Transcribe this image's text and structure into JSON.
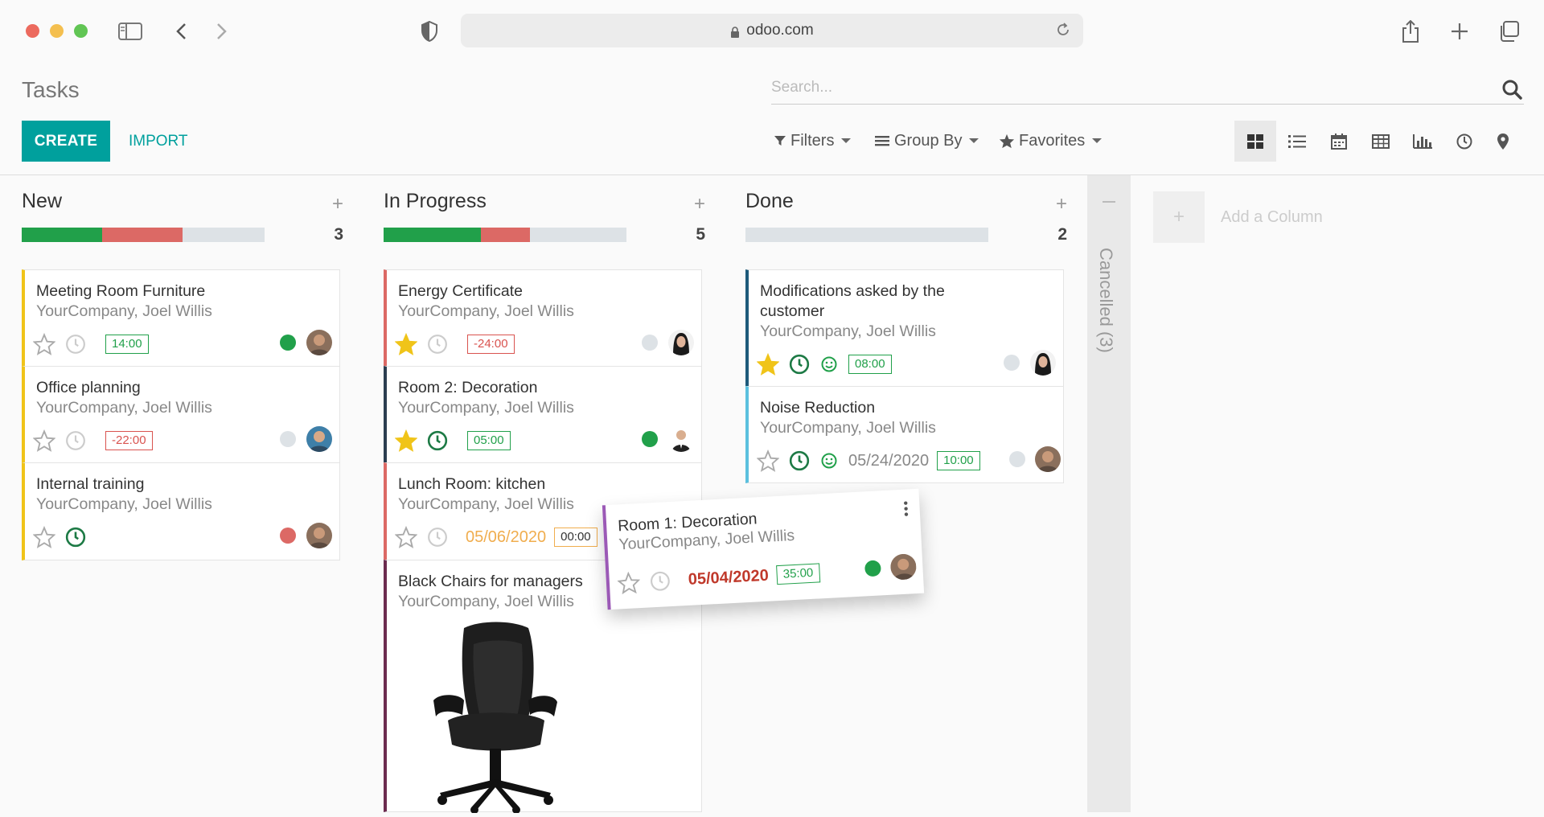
{
  "browser": {
    "url": "odoo.com"
  },
  "control_panel": {
    "breadcrumb": "Tasks",
    "search_placeholder": "Search...",
    "create_label": "CREATE",
    "import_label": "IMPORT",
    "filters_label": "Filters",
    "group_by_label": "Group By",
    "favorites_label": "Favorites",
    "views": [
      "kanban",
      "list",
      "calendar",
      "pivot",
      "graph",
      "activity",
      "map"
    ],
    "active_view": "kanban"
  },
  "columns": [
    {
      "title": "New",
      "count": "3",
      "progress": {
        "green": 0.33,
        "red": 0.33
      },
      "cards": [
        {
          "title": "Meeting Room Furniture",
          "subtitle": "YourCompany, Joel Willis",
          "starred": false,
          "activity": "none",
          "deadline": "",
          "deadline_color": "",
          "hours": "14:00",
          "hours_color": "green",
          "state": "green",
          "avatar": "man1"
        },
        {
          "title": "Office planning",
          "subtitle": "YourCompany, Joel Willis",
          "starred": false,
          "activity": "none",
          "deadline": "",
          "deadline_color": "",
          "hours": "-22:00",
          "hours_color": "red",
          "state": "grey",
          "avatar": "man2"
        },
        {
          "title": "Internal training",
          "subtitle": "YourCompany, Joel Willis",
          "starred": false,
          "activity": "planned",
          "deadline": "",
          "deadline_color": "",
          "hours": "",
          "hours_color": "",
          "state": "red",
          "avatar": "man1"
        }
      ]
    },
    {
      "title": "In Progress",
      "count": "5",
      "progress": {
        "green": 0.4,
        "red": 0.2
      },
      "cards": [
        {
          "title": "Energy Certificate",
          "subtitle": "YourCompany, Joel Willis",
          "starred": true,
          "activity": "none",
          "deadline": "",
          "hours": "-24:00",
          "hours_color": "red",
          "state": "grey",
          "avatar": "woman"
        },
        {
          "title": "Room 2: Decoration",
          "subtitle": "YourCompany, Joel Willis",
          "starred": true,
          "activity": "planned",
          "deadline": "",
          "hours": "05:00",
          "hours_color": "green",
          "state": "green",
          "avatar": "suit"
        },
        {
          "title": "Lunch Room: kitchen",
          "subtitle": "YourCompany, Joel Willis",
          "starred": false,
          "activity": "none",
          "deadline": "05/06/2020",
          "deadline_color": "orange",
          "hours": "00:00",
          "hours_color": "orange",
          "state": "",
          "avatar": ""
        },
        {
          "title": "Black Chairs for managers",
          "subtitle": "YourCompany, Joel Willis",
          "starred": false,
          "activity": "",
          "deadline": "",
          "hours": "",
          "state": "",
          "avatar": "",
          "image": "office-chair"
        }
      ]
    },
    {
      "title": "Done",
      "count": "2",
      "progress": {
        "green": 0,
        "red": 0
      },
      "cards": [
        {
          "title": "Modifications asked by the customer",
          "subtitle": "YourCompany, Joel Willis",
          "starred": true,
          "activity": "planned",
          "satisfaction": true,
          "deadline": "",
          "hours": "08:00",
          "hours_color": "green",
          "state": "grey",
          "avatar": "woman"
        },
        {
          "title": "Noise Reduction",
          "subtitle": "YourCompany, Joel Willis",
          "starred": false,
          "activity": "planned",
          "satisfaction": true,
          "deadline": "05/24/2020",
          "deadline_color": "gray",
          "hours": "10:00",
          "hours_color": "green",
          "state": "grey",
          "avatar": "man1"
        }
      ]
    }
  ],
  "folded_column": {
    "label": "Cancelled (3)"
  },
  "add_column_label": "Add a Column",
  "dragged_card": {
    "title": "Room 1: Decoration",
    "subtitle": "YourCompany, Joel Willis",
    "deadline": "05/04/2020",
    "hours": "35:00",
    "state": "green",
    "avatar": "man1"
  },
  "colors": {
    "primary": "#00a09d",
    "green": "#21a04a",
    "red": "#dc6965",
    "star": "#f0c419"
  }
}
